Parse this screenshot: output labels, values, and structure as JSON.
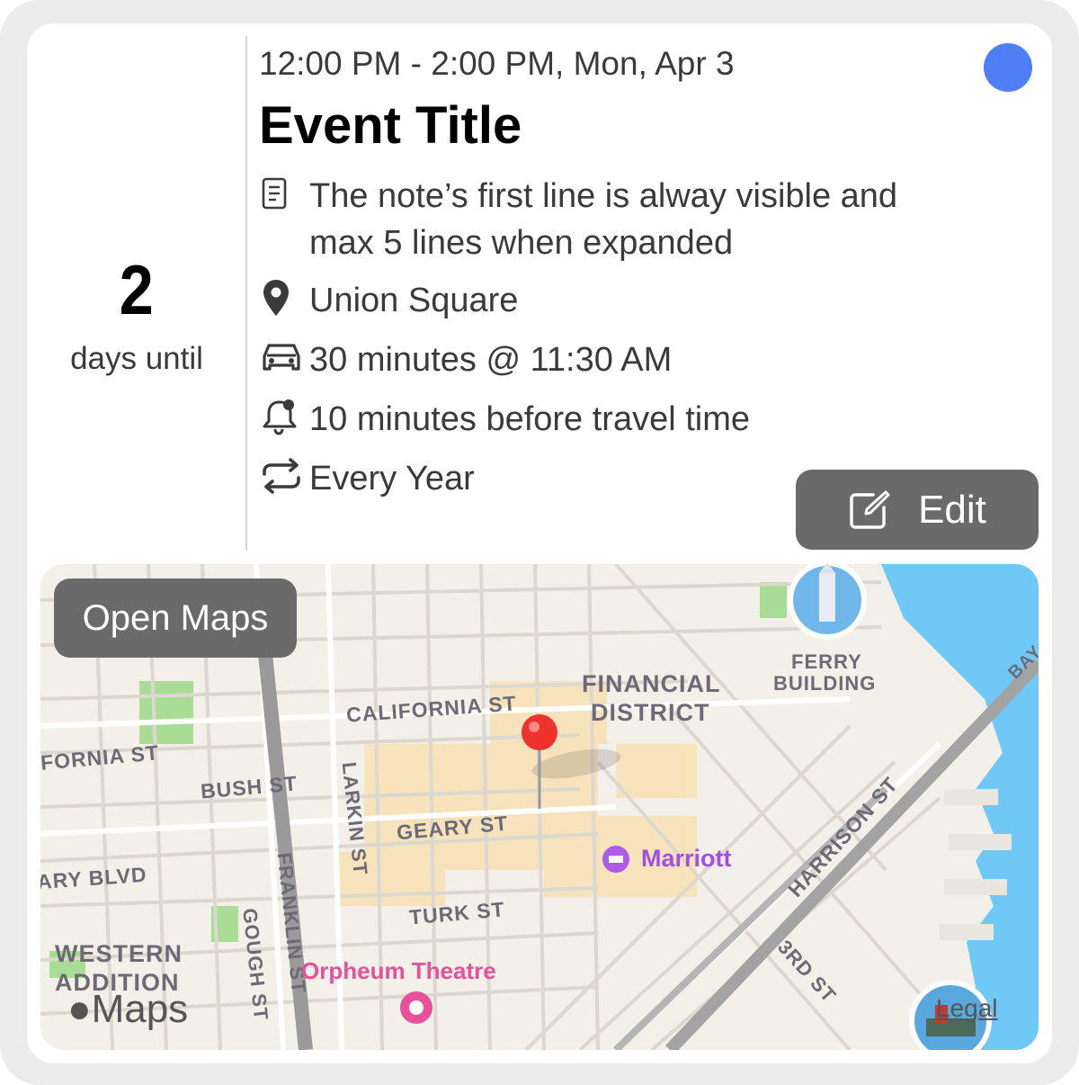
{
  "countdown": {
    "number": "2",
    "label": "days until"
  },
  "event": {
    "time": "12:00 PM - 2:00 PM, Mon, Apr 3",
    "title": "Event Title",
    "calendar_color": "#4f7ef7",
    "note_line1": "The note’s first line is alway visible and",
    "note_line2": "max 5 lines when expanded",
    "location": "Union Square",
    "travel": "30 minutes @ 11:30 AM",
    "alert": "10 minutes before travel time",
    "repeat": "Every Year"
  },
  "buttons": {
    "edit": "Edit",
    "open_maps": "Open Maps"
  },
  "map": {
    "labels": {
      "california": "CALIFORNIA ST",
      "fornia": "FORNIA ST",
      "bush": "BUSH ST",
      "larkin": "LARKIN ST",
      "geary": "GEARY ST",
      "ary_blvd": "ARY BLVD",
      "franklin": "FRANKLIN ST",
      "gough": "GOUGH ST",
      "turk": "TURK ST",
      "western": "WESTERN",
      "addition": "ADDITION",
      "financial": "FINANCIAL",
      "district": "DISTRICT",
      "ferry": "FERRY",
      "building": "BUILDING",
      "harrison": "HARRISON ST",
      "third": "3RD ST",
      "bay": "BAY",
      "marriott": "Marriott",
      "orpheum": "Orpheum Theatre"
    },
    "logo": "Maps",
    "legal": "Legal",
    "water_color": "#6fc8f5",
    "pin_color": "#f0322e"
  }
}
